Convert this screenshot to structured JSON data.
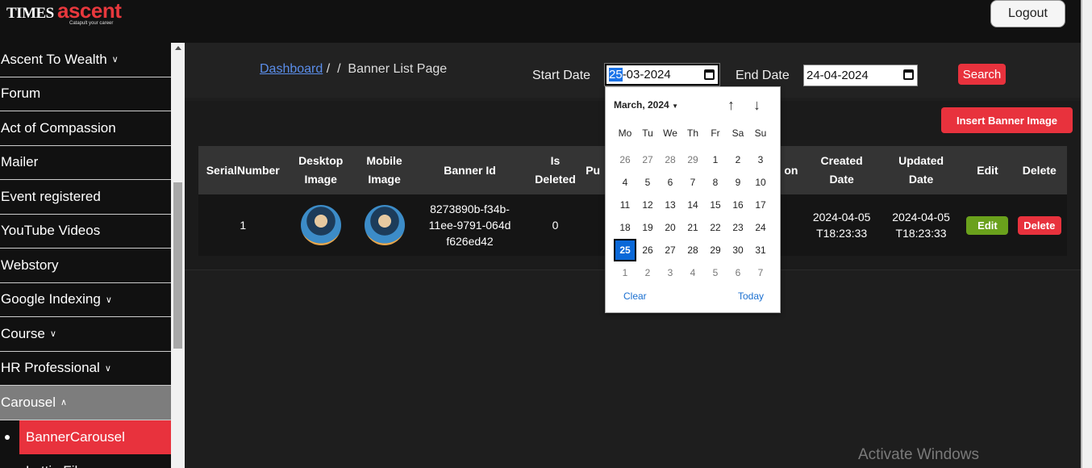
{
  "brand": {
    "part1": "TIMES",
    "part2": "ascent",
    "tagline": "Catapult your career"
  },
  "header": {
    "logout_label": "Logout"
  },
  "sidebar": {
    "items": [
      {
        "label": "Ascent To Wealth",
        "chevron": "down"
      },
      {
        "label": "Forum"
      },
      {
        "label": "Act of Compassion"
      },
      {
        "label": "Mailer"
      },
      {
        "label": "Event registered"
      },
      {
        "label": "YouTube Videos"
      },
      {
        "label": "Webstory"
      },
      {
        "label": "Google Indexing",
        "chevron": "down"
      },
      {
        "label": "Course",
        "chevron": "down"
      },
      {
        "label": "HR Professional",
        "chevron": "down"
      },
      {
        "label": "Carousel",
        "chevron": "up"
      }
    ],
    "subitems": [
      {
        "label": "BannerCarousel"
      },
      {
        "label": "Lottie Files"
      }
    ]
  },
  "breadcrumb": {
    "link": "Dashboard",
    "sep": "/  / ",
    "current": "Banner List Page"
  },
  "filters": {
    "start_label": "Start Date",
    "start_selected_part": "25",
    "start_rest": "-03-2024",
    "end_label": "End Date",
    "end_value": "24-04-2024",
    "search_label": "Search"
  },
  "actions": {
    "insert_label": "Insert Banner Image"
  },
  "table": {
    "headers": [
      "SerialNumber",
      "Desktop Image",
      "Mobile Image",
      "Banner Id",
      "Is Deleted",
      "Pu",
      "on",
      "Created Date",
      "Updated Date",
      "Edit",
      "Delete"
    ],
    "rows": [
      {
        "serial": "1",
        "banner_id": "8273890b-f34b-11ee-9791-064df626ed42",
        "is_deleted": "0",
        "created": "2024-04-05T18:23:33",
        "updated": "2024-04-05T18:23:33",
        "edit_label": "Edit",
        "delete_label": "Delete"
      }
    ]
  },
  "calendar": {
    "month_label": "March, 2024",
    "dows": [
      "Mo",
      "Tu",
      "We",
      "Th",
      "Fr",
      "Sa",
      "Su"
    ],
    "days": [
      {
        "n": "26",
        "o": true
      },
      {
        "n": "27",
        "o": true
      },
      {
        "n": "28",
        "o": true
      },
      {
        "n": "29",
        "o": true
      },
      {
        "n": "1"
      },
      {
        "n": "2"
      },
      {
        "n": "3"
      },
      {
        "n": "4"
      },
      {
        "n": "5"
      },
      {
        "n": "6"
      },
      {
        "n": "7"
      },
      {
        "n": "8"
      },
      {
        "n": "9"
      },
      {
        "n": "10"
      },
      {
        "n": "11"
      },
      {
        "n": "12"
      },
      {
        "n": "13"
      },
      {
        "n": "14"
      },
      {
        "n": "15"
      },
      {
        "n": "16"
      },
      {
        "n": "17"
      },
      {
        "n": "18"
      },
      {
        "n": "19"
      },
      {
        "n": "20"
      },
      {
        "n": "21"
      },
      {
        "n": "22"
      },
      {
        "n": "23"
      },
      {
        "n": "24"
      },
      {
        "n": "25",
        "sel": true
      },
      {
        "n": "26"
      },
      {
        "n": "27"
      },
      {
        "n": "28"
      },
      {
        "n": "29"
      },
      {
        "n": "30"
      },
      {
        "n": "31"
      },
      {
        "n": "1",
        "o": true
      },
      {
        "n": "2",
        "o": true
      },
      {
        "n": "3",
        "o": true
      },
      {
        "n": "4",
        "o": true
      },
      {
        "n": "5",
        "o": true
      },
      {
        "n": "6",
        "o": true
      },
      {
        "n": "7",
        "o": true
      }
    ],
    "clear_label": "Clear",
    "today_label": "Today"
  },
  "watermark": "Activate Windows"
}
